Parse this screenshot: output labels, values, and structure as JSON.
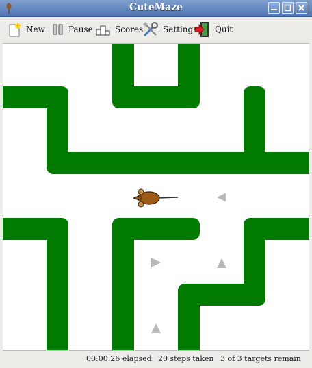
{
  "window": {
    "title": "CuteMaze"
  },
  "toolbar": {
    "new_label": "New",
    "pause_label": "Pause",
    "scores_label": "Scores",
    "settings_label": "Settings",
    "quit_label": "Quit"
  },
  "status": {
    "elapsed": "00:00:26 elapsed",
    "steps": "20 steps taken",
    "targets": "3 of 3 targets remain"
  },
  "colors": {
    "wall": "#007a00",
    "target": "#b8b8b8",
    "player": "#9c5a14"
  }
}
